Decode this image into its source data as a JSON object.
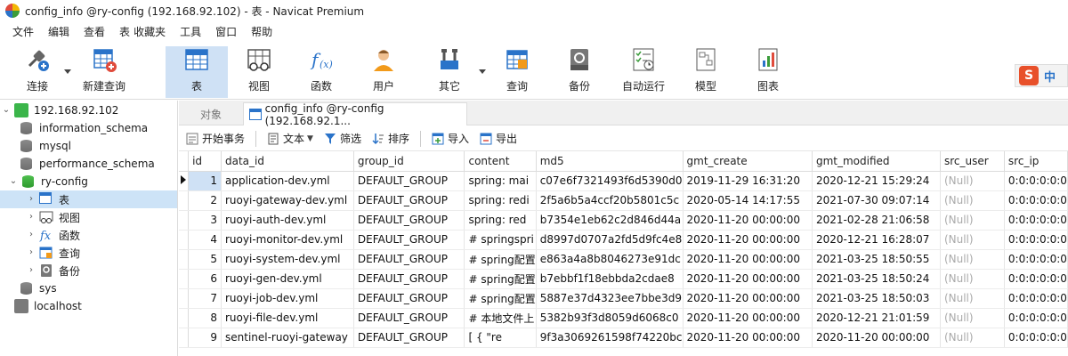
{
  "window": {
    "title": "config_info @ry-config (192.168.92.102) - 表 - Navicat Premium"
  },
  "menu": [
    "文件",
    "编辑",
    "查看",
    "表",
    "收藏夹",
    "工具",
    "窗口",
    "帮助"
  ],
  "toolbar": {
    "items": [
      {
        "label": "连接",
        "icon": "connection-icon"
      },
      {
        "label": "新建查询",
        "icon": "new-query-icon"
      },
      {
        "label": "表",
        "icon": "table-icon",
        "active": true
      },
      {
        "label": "视图",
        "icon": "view-icon"
      },
      {
        "label": "函数",
        "icon": "function-icon"
      },
      {
        "label": "用户",
        "icon": "user-icon"
      },
      {
        "label": "其它",
        "icon": "tools-icon"
      },
      {
        "label": "查询",
        "icon": "query-icon"
      },
      {
        "label": "备份",
        "icon": "backup-icon"
      },
      {
        "label": "自动运行",
        "icon": "auto-run-icon"
      },
      {
        "label": "模型",
        "icon": "model-icon"
      },
      {
        "label": "图表",
        "icon": "chart-icon"
      }
    ]
  },
  "ime": {
    "badge": "S",
    "label": "中"
  },
  "sidebar": {
    "connection": "192.168.92.102",
    "databases": [
      "information_schema",
      "mysql",
      "performance_schema",
      "ry-config",
      "sys"
    ],
    "children": [
      "表",
      "视图",
      "函数",
      "查询",
      "备份"
    ],
    "localhost": "localhost"
  },
  "tabs": {
    "objects": "对象",
    "active": "config_info @ry-config (192.168.92.1..."
  },
  "subtoolbar": {
    "begin_tx": "开始事务",
    "text": "文本",
    "filter": "筛选",
    "sort": "排序",
    "import": "导入",
    "export": "导出"
  },
  "grid": {
    "columns": [
      "id",
      "data_id",
      "group_id",
      "content",
      "md5",
      "gmt_create",
      "gmt_modified",
      "src_user",
      "src_ip"
    ],
    "rows": [
      [
        "1",
        "application-dev.yml",
        "DEFAULT_GROUP",
        "spring:  mai",
        "c07e6f7321493f6d5390d0",
        "2019-11-29 16:31:20",
        "2020-12-21 15:29:24",
        "(Null)",
        "0:0:0:0:0:0"
      ],
      [
        "2",
        "ruoyi-gateway-dev.yml",
        "DEFAULT_GROUP",
        "spring:  redi",
        "2f5a6b5a4ccf20b5801c5c",
        "2020-05-14 14:17:55",
        "2021-07-30 09:07:14",
        "(Null)",
        "0:0:0:0:0:0"
      ],
      [
        "3",
        "ruoyi-auth-dev.yml",
        "DEFAULT_GROUP",
        "spring:   red",
        "b7354e1eb62c2d846d44a",
        "2020-11-20 00:00:00",
        "2021-02-28 21:06:58",
        "(Null)",
        "0:0:0:0:0:0"
      ],
      [
        "4",
        "ruoyi-monitor-dev.yml",
        "DEFAULT_GROUP",
        "# springspri",
        "d8997d0707a2fd5d9fc4e8",
        "2020-11-20 00:00:00",
        "2020-12-21 16:28:07",
        "(Null)",
        "0:0:0:0:0:0"
      ],
      [
        "5",
        "ruoyi-system-dev.yml",
        "DEFAULT_GROUP",
        "# spring配置",
        "e863a4a8b8046273e91dc",
        "2020-11-20 00:00:00",
        "2021-03-25 18:50:55",
        "(Null)",
        "0:0:0:0:0:0"
      ],
      [
        "6",
        "ruoyi-gen-dev.yml",
        "DEFAULT_GROUP",
        "# spring配置",
        "b7ebbf1f18ebbda2cdae8",
        "2020-11-20 00:00:00",
        "2021-03-25 18:50:24",
        "(Null)",
        "0:0:0:0:0:0"
      ],
      [
        "7",
        "ruoyi-job-dev.yml",
        "DEFAULT_GROUP",
        "# spring配置",
        "5887e37d4323ee7bbe3d9",
        "2020-11-20 00:00:00",
        "2021-03-25 18:50:03",
        "(Null)",
        "0:0:0:0:0:0"
      ],
      [
        "8",
        "ruoyi-file-dev.yml",
        "DEFAULT_GROUP",
        "# 本地文件上",
        "5382b93f3d8059d6068c0",
        "2020-11-20 00:00:00",
        "2020-12-21 21:01:59",
        "(Null)",
        "0:0:0:0:0:0"
      ],
      [
        "9",
        "sentinel-ruoyi-gateway",
        "DEFAULT_GROUP",
        "[    {        \"re",
        "9f3a3069261598f74220bc",
        "2020-11-20 00:00:00",
        "2020-11-20 00:00:00",
        "(Null)",
        "0:0:0:0:0:0"
      ]
    ]
  }
}
